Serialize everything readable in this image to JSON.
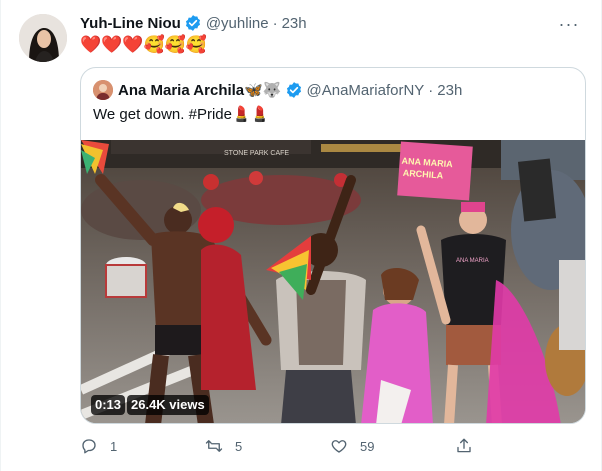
{
  "tweet": {
    "author_name": "Yuh-Line Niou",
    "author_handle": "@yuhline",
    "time": "23h",
    "separator": "·",
    "more_label": "···",
    "text": "❤️❤️❤️🥰🥰🥰"
  },
  "quoted": {
    "author_name": "Ana Maria Archila🦋🐺",
    "author_handle": "@AnaMariaforNY",
    "time": "23h",
    "separator": "·",
    "text": "We get down. #Pride💄💄",
    "video": {
      "duration": "0:13",
      "views": "26.4K views",
      "sign_text_1": "ANA MARIA",
      "sign_text_2": "ARCHILA",
      "store_sign": "STONE PARK CAFE",
      "shirt_text": "ANA MARIA"
    }
  },
  "actions": {
    "reply_count": "1",
    "retweet_count": "5",
    "like_count": "59"
  },
  "colors": {
    "verified": "#1d9bf0",
    "muted": "#536471",
    "border": "#cfd9de"
  }
}
